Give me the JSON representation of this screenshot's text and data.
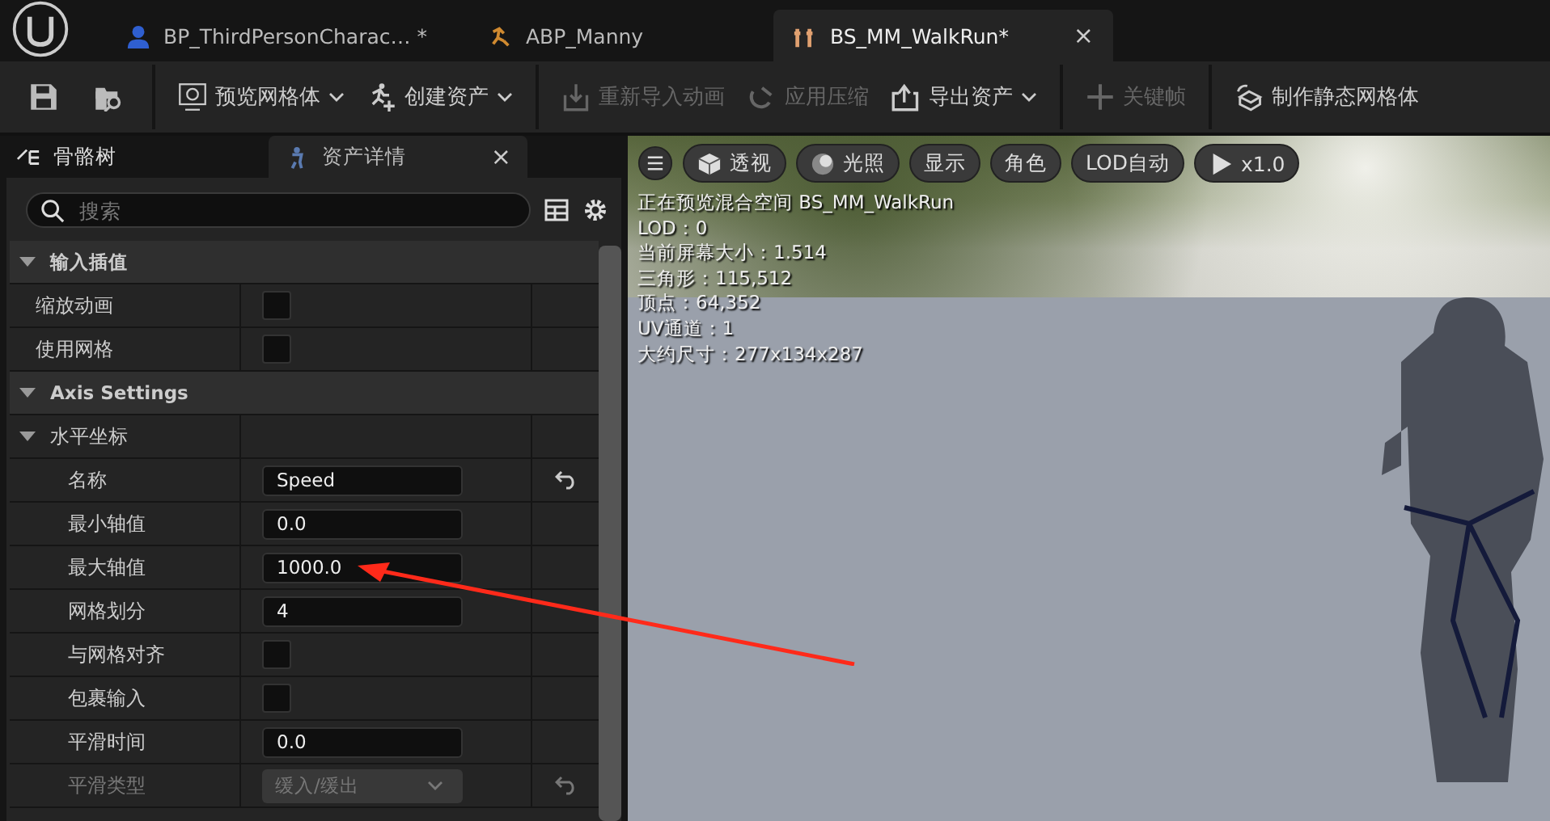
{
  "editor_tabs": [
    {
      "label": "BP_ThirdPersonCharac… *",
      "selected": false
    },
    {
      "label": "ABP_Manny",
      "selected": false
    },
    {
      "label": "BS_MM_WalkRun*",
      "selected": true,
      "close": "×"
    }
  ],
  "toolbar": {
    "items": [
      {
        "label": "预览网格体",
        "dropdown": true,
        "disabled": false
      },
      {
        "label": "创建资产",
        "dropdown": true,
        "disabled": false
      },
      {
        "label": "重新导入动画",
        "dropdown": false,
        "disabled": true
      },
      {
        "label": "应用压缩",
        "dropdown": false,
        "disabled": true
      },
      {
        "label": "导出资产",
        "dropdown": true,
        "disabled": false
      },
      {
        "label": "关键帧",
        "dropdown": false,
        "disabled": true
      },
      {
        "label": "制作静态网格体",
        "dropdown": false,
        "disabled": false
      }
    ]
  },
  "panel_tabs": [
    {
      "label": "骨骼树",
      "selected": false
    },
    {
      "label": "资产详情",
      "selected": true,
      "close": "×"
    }
  ],
  "search": {
    "placeholder": "搜索"
  },
  "details": [
    {
      "kind": "category",
      "label": "输入插值",
      "expanded": true,
      "children": [
        {
          "kind": "checkbox",
          "label": "缩放动画",
          "checked": false,
          "disabled": false
        },
        {
          "kind": "checkbox",
          "label": "使用网格",
          "checked": false,
          "disabled": false
        }
      ]
    },
    {
      "kind": "category",
      "label": "Axis Settings",
      "expanded": true,
      "children": [
        {
          "kind": "group",
          "label": "水平坐标",
          "expanded": true,
          "children": [
            {
              "kind": "text",
              "label": "名称",
              "value": "Speed",
              "reset": true,
              "disabled": false
            },
            {
              "kind": "text",
              "label": "最小轴值",
              "value": "0.0",
              "reset": false,
              "disabled": false
            },
            {
              "kind": "text",
              "label": "最大轴值",
              "value": "1000.0",
              "reset": false,
              "disabled": false
            },
            {
              "kind": "text",
              "label": "网格划分",
              "value": "4",
              "reset": false,
              "disabled": false
            },
            {
              "kind": "checkbox",
              "label": "与网格对齐",
              "checked": false,
              "disabled": false
            },
            {
              "kind": "checkbox",
              "label": "包裹输入",
              "checked": false,
              "disabled": false
            },
            {
              "kind": "text",
              "label": "平滑时间",
              "value": "0.0",
              "reset": false,
              "disabled": false
            },
            {
              "kind": "dropdown",
              "label": "平滑类型",
              "value": "缓入/缓出",
              "reset": true,
              "disabled": true
            }
          ]
        }
      ]
    }
  ],
  "viewport": {
    "buttons": [
      {
        "label": "透视"
      },
      {
        "label": "光照"
      },
      {
        "label": "显示"
      },
      {
        "label": "角色"
      },
      {
        "label": "LOD自动"
      },
      {
        "label": "x1.0"
      }
    ],
    "info": [
      "正在预览混合空间 BS_MM_WalkRun",
      "LOD：0",
      "当前屏幕大小：1.514",
      "三角形：115,512",
      "顶点：64,352",
      "UV通道：1",
      "大约尺寸：277x134x287"
    ]
  }
}
